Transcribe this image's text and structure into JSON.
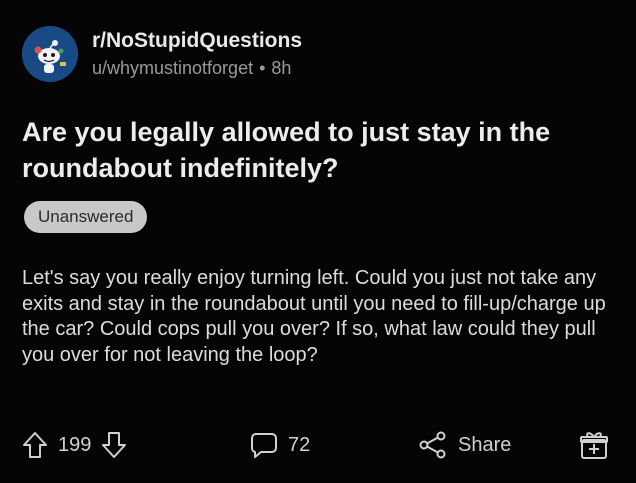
{
  "post": {
    "subreddit": "r/NoStupidQuestions",
    "author": "u/whymustinotforget",
    "separator": "•",
    "age": "8h",
    "title": "Are you legally allowed to just stay in the roundabout indefinitely?",
    "flair": "Unanswered",
    "body": "Let's say you really enjoy turning left. Could you just not take any exits and stay in the roundabout until you need to fill-up/charge up the car? Could cops pull you over? If so, what law could they pull you over for not leaving the loop?"
  },
  "actions": {
    "upvotes": "199",
    "comments": "72",
    "share_label": "Share"
  },
  "icons": {
    "avatar": "subreddit-avatar-icon",
    "upvote": "upvote-arrow-icon",
    "downvote": "downvote-arrow-icon",
    "comment": "comment-bubble-icon",
    "share": "share-icon",
    "award": "gift-award-icon"
  },
  "colors": {
    "background": "#050505",
    "avatar_bg": "#1a4a86",
    "flair_bg": "#c8c8c8",
    "text": "#dcdcdc",
    "muted": "#9a9a9a"
  }
}
